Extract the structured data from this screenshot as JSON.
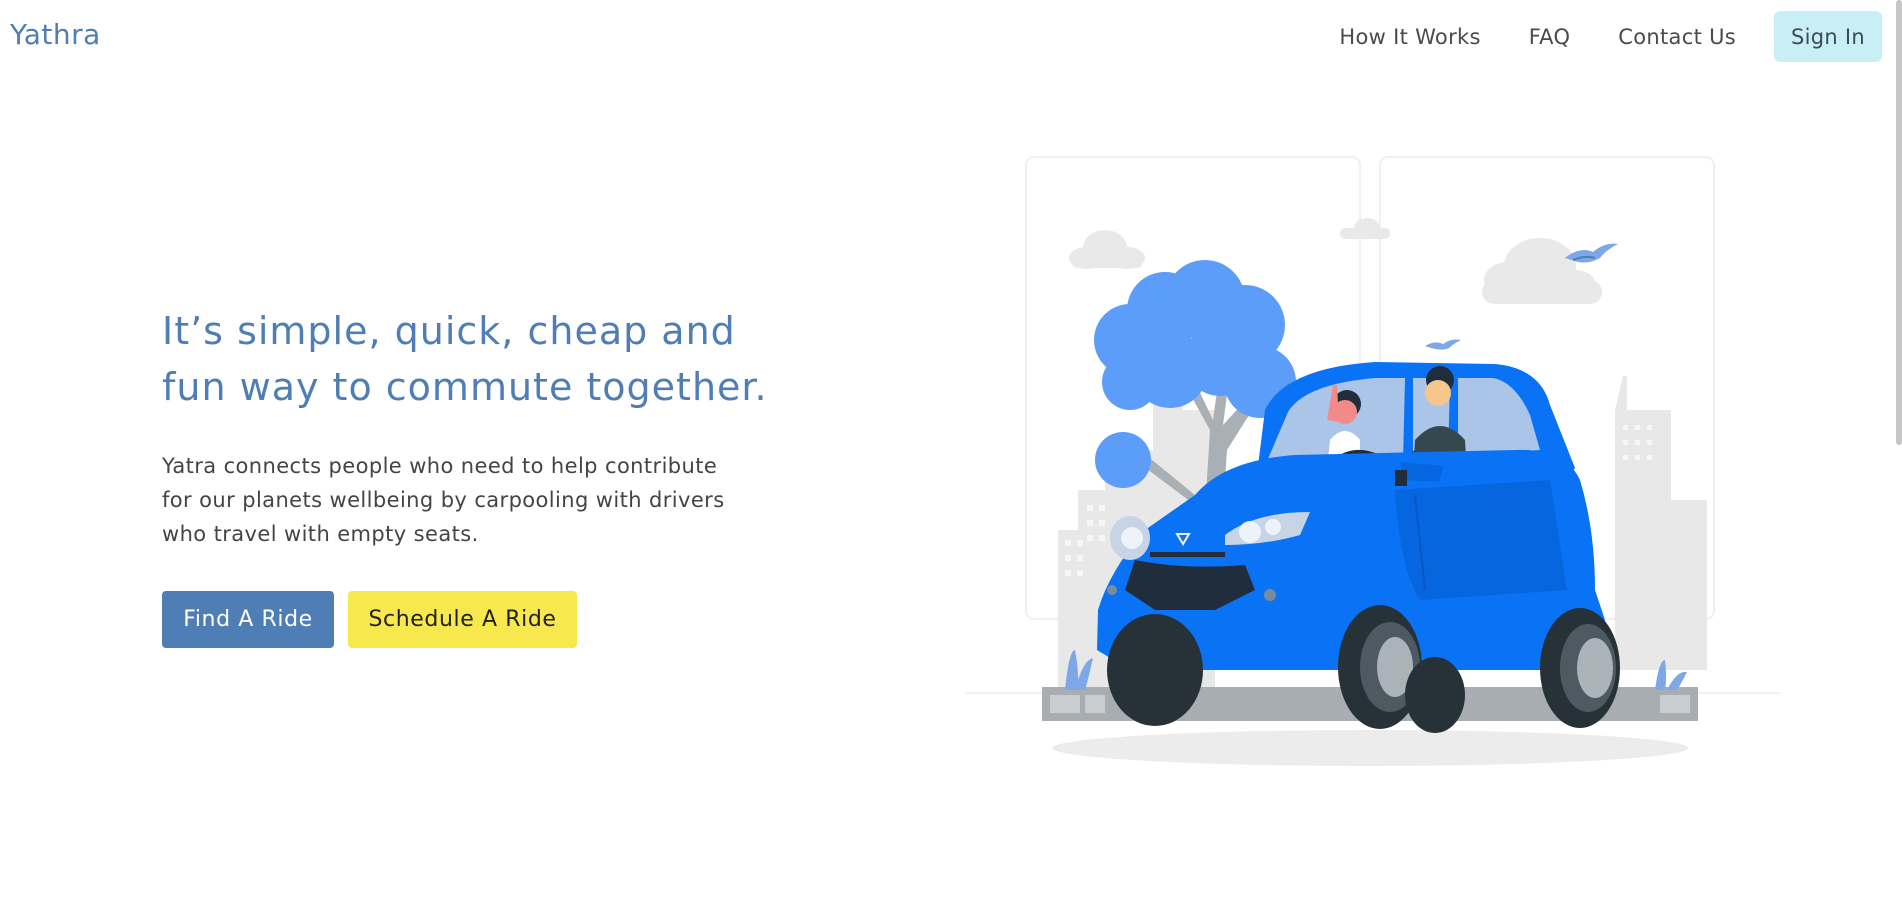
{
  "brand": "Yathra",
  "nav": {
    "how_it_works": "How It Works",
    "faq": "FAQ",
    "contact": "Contact Us",
    "sign_in": "Sign In"
  },
  "hero": {
    "title": "It’s simple, quick, cheap and fun way to commute together.",
    "description": "Yatra connects people who need to help contribute for our planets wellbeing by carpooling with drivers who travel with empty seats.",
    "find_ride": "Find A Ride",
    "schedule_ride": "Schedule A Ride"
  },
  "colors": {
    "primary": "#4f7db5",
    "accent_yellow": "#f7e84e",
    "signin_bg": "#c8eff5",
    "car_blue": "#0a73f5",
    "tree_blue": "#5b9df9"
  },
  "icons": {
    "illustration": "carpool-illustration"
  }
}
